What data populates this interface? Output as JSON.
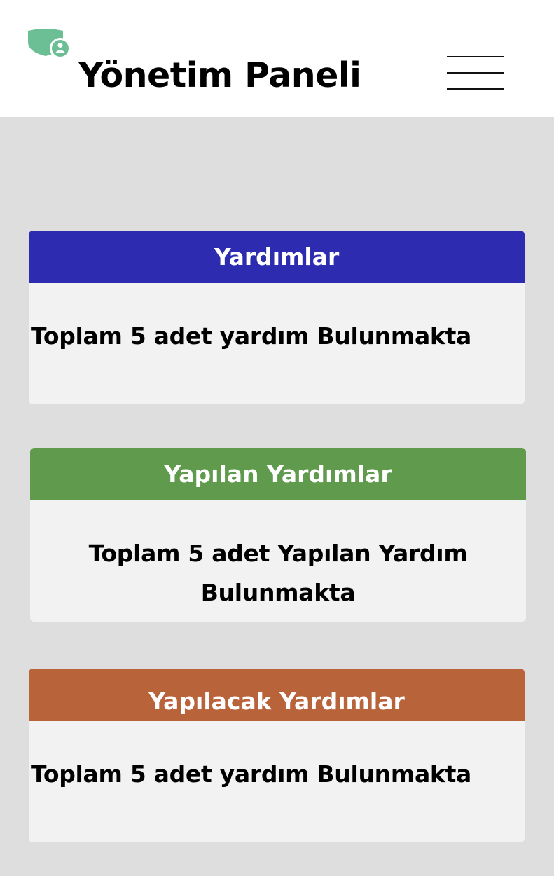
{
  "header": {
    "title": "Yönetim Paneli",
    "logo_icon": "shield-user-icon",
    "menu_icon": "hamburger-menu-icon",
    "logo_color": "#6cbf95"
  },
  "cards": [
    {
      "title": "Yardımlar",
      "text": "Toplam 5 adet yardım Bulunmakta",
      "header_color": "#2d2cb1"
    },
    {
      "title": "Yapılan Yardımlar",
      "text": "Toplam 5 adet Yapılan Yardım Bulunmakta",
      "header_color": "#609a4c"
    },
    {
      "title": "Yapılacak Yardımlar",
      "text": "Toplam 5 adet yardım Bulunmakta",
      "header_color": "#b9633b"
    }
  ]
}
